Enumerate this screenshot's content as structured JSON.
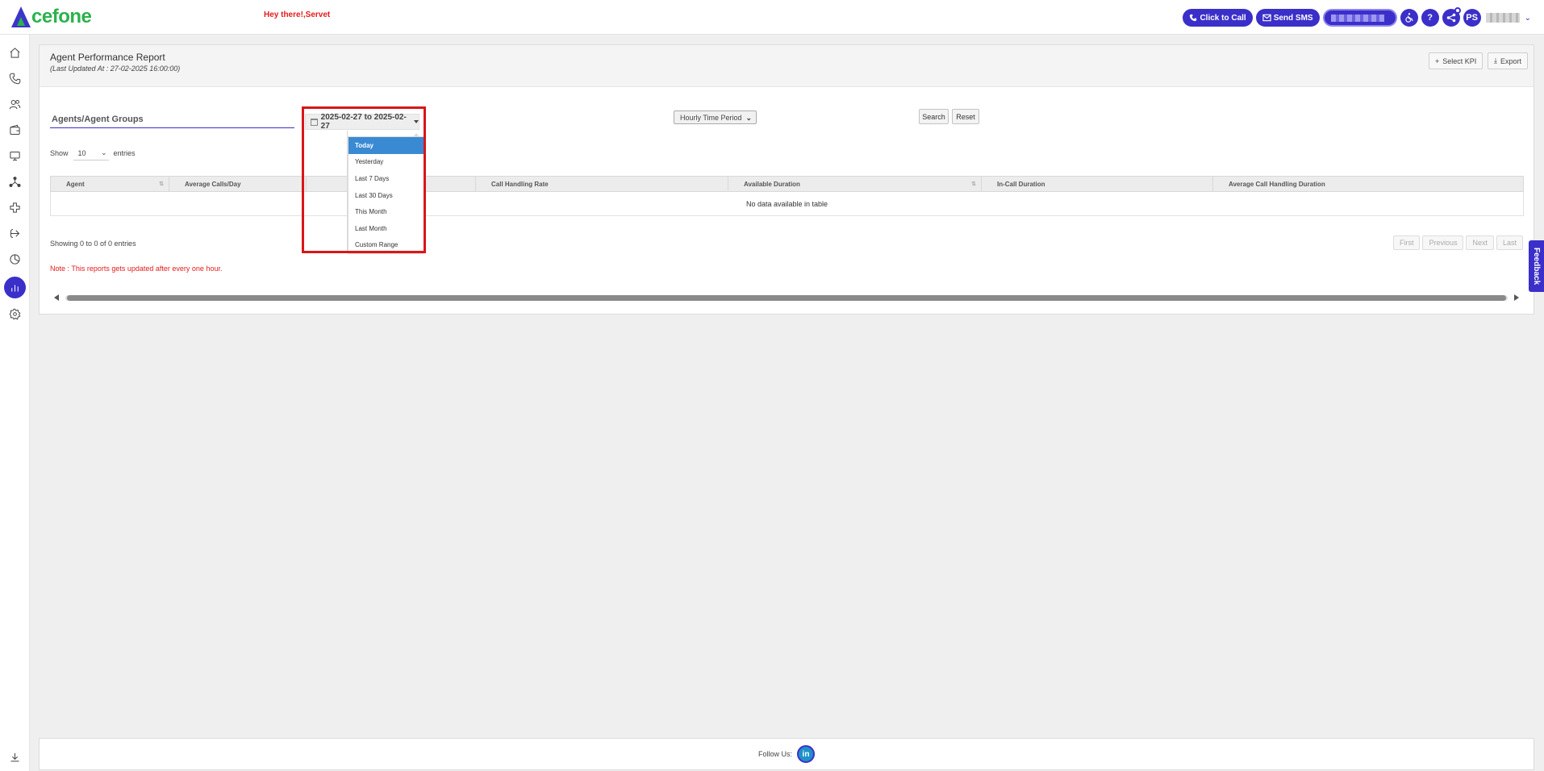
{
  "header": {
    "logo_text": "cefone",
    "greeting": "Hey there!,Servet",
    "click_to_call": "Click to Call",
    "send_sms": "Send SMS",
    "user_initials": "PS",
    "help_symbol": "?"
  },
  "sidebar": {
    "items": [
      {
        "icon": "home-icon"
      },
      {
        "icon": "phone-icon"
      },
      {
        "icon": "users-icon"
      },
      {
        "icon": "wallet-icon"
      },
      {
        "icon": "monitor-icon"
      },
      {
        "icon": "network-icon"
      },
      {
        "icon": "puzzle-icon"
      },
      {
        "icon": "routing-icon"
      },
      {
        "icon": "pie-chart-icon"
      },
      {
        "icon": "bar-chart-icon",
        "active": true
      },
      {
        "icon": "settings-icon"
      },
      {
        "icon": "download-icon"
      }
    ]
  },
  "report": {
    "title": "Agent Performance Report",
    "last_updated": "(Last Updated At : 27-02-2025 16:00:00)",
    "select_kpi": "Select KPI",
    "export": "Export",
    "agents_label": "Agents/Agent Groups",
    "date_range": "2025-02-27 to 2025-02-27",
    "time_period": "Hourly Time Period",
    "search": "Search",
    "reset": "Reset",
    "show_label": "Show",
    "page_size": "10",
    "entries_label": "entries",
    "columns": [
      "Agent",
      "Average Calls/Day",
      "",
      "Call Handling Rate",
      "Available Duration",
      "In-Call Duration",
      "Average Call Handling Duration"
    ],
    "empty_message": "No data available in table",
    "showing": "Showing 0 to 0 of 0 entries",
    "pager": [
      "First",
      "Previous",
      "Next",
      "Last"
    ],
    "note": "Note : This reports gets updated after every one hour."
  },
  "date_ranges": {
    "options": [
      "Today",
      "Yesterday",
      "Last 7 Days",
      "Last 30 Days",
      "This Month",
      "Last Month",
      "Custom Range"
    ],
    "selected": "Today"
  },
  "feedback": "Feedback",
  "footer": {
    "follow_us": "Follow Us:",
    "linkedin": "in"
  },
  "colors": {
    "brand": "#3b2fc9",
    "logo_green": "#2bb24c",
    "note_red": "#e51b1b",
    "highlight": "#d8161a",
    "active_range": "#3a8ad3"
  }
}
